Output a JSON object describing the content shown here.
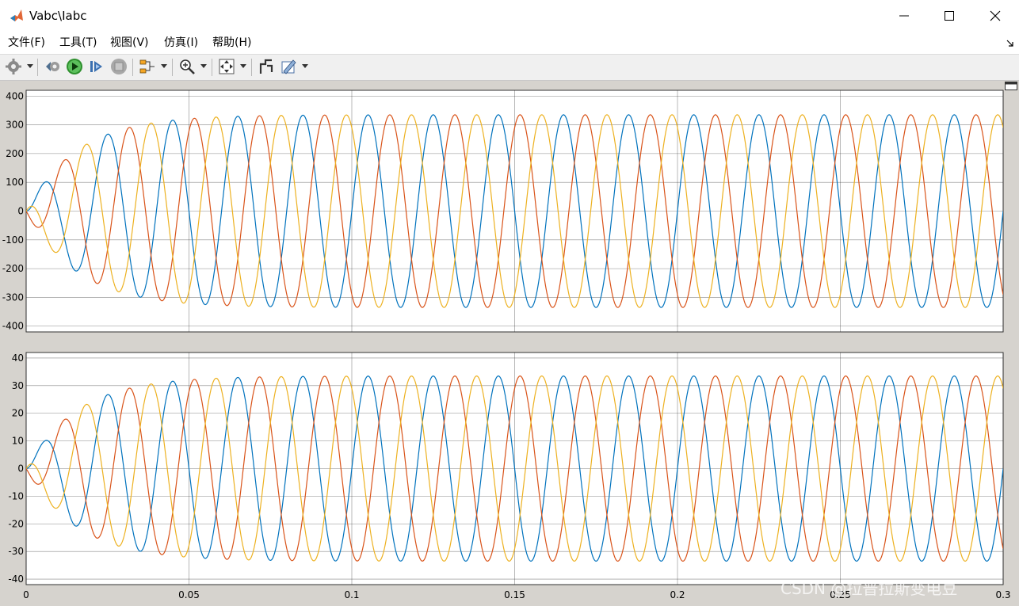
{
  "window": {
    "title": "Vabc\\Iabc"
  },
  "menu": [
    {
      "label": "文件(F)"
    },
    {
      "label": "工具(T)"
    },
    {
      "label": "视图(V)"
    },
    {
      "label": "仿真(I)"
    },
    {
      "label": "帮助(H)"
    }
  ],
  "toolbar": {
    "buttons": [
      "settings-icon",
      "restore-config-icon",
      "run-icon",
      "step-forward-icon",
      "stop-icon",
      "signal-selector-icon",
      "zoom-icon",
      "autoscale-icon",
      "cursor-measure-icon",
      "style-icon"
    ]
  },
  "colors": {
    "phase_a": "#0072bd",
    "phase_b": "#d95319",
    "phase_c": "#edb120",
    "grid": "#262626"
  },
  "watermark": "CSDN @拉普拉斯变电豆",
  "chart_data": [
    {
      "type": "line",
      "title": "",
      "xlim": [
        0,
        0.3
      ],
      "ylim": [
        -420,
        420
      ],
      "yticks": [
        -400,
        -300,
        -200,
        -100,
        0,
        100,
        200,
        300,
        400
      ],
      "xticks": [
        0,
        0.05,
        0.1,
        0.15,
        0.2,
        0.25,
        0.3
      ],
      "grid": true,
      "waveform": {
        "frequency_hz": 50,
        "steady_amplitude": 335,
        "phase_shift_deg": 120,
        "settling_time_s": 0.05
      },
      "series": [
        {
          "color": "#0072bd",
          "phase_deg": 0
        },
        {
          "color": "#d95319",
          "phase_deg": -120
        },
        {
          "color": "#edb120",
          "phase_deg": 120
        }
      ]
    },
    {
      "type": "line",
      "title": "",
      "xlim": [
        0,
        0.3
      ],
      "ylim": [
        -42,
        42
      ],
      "yticks": [
        -40,
        -30,
        -20,
        -10,
        0,
        10,
        20,
        30,
        40
      ],
      "xticks": [
        0,
        0.05,
        0.1,
        0.15,
        0.2,
        0.25,
        0.3
      ],
      "xticklabels": [
        "0",
        "0.05",
        "0.1",
        "0.15",
        "0.2",
        "0.25",
        "0.3"
      ],
      "grid": true,
      "waveform": {
        "frequency_hz": 50,
        "steady_amplitude": 33.5,
        "phase_shift_deg": 120,
        "settling_time_s": 0.05
      },
      "series": [
        {
          "color": "#0072bd",
          "phase_deg": 0
        },
        {
          "color": "#d95319",
          "phase_deg": -120
        },
        {
          "color": "#edb120",
          "phase_deg": 120
        }
      ]
    }
  ]
}
